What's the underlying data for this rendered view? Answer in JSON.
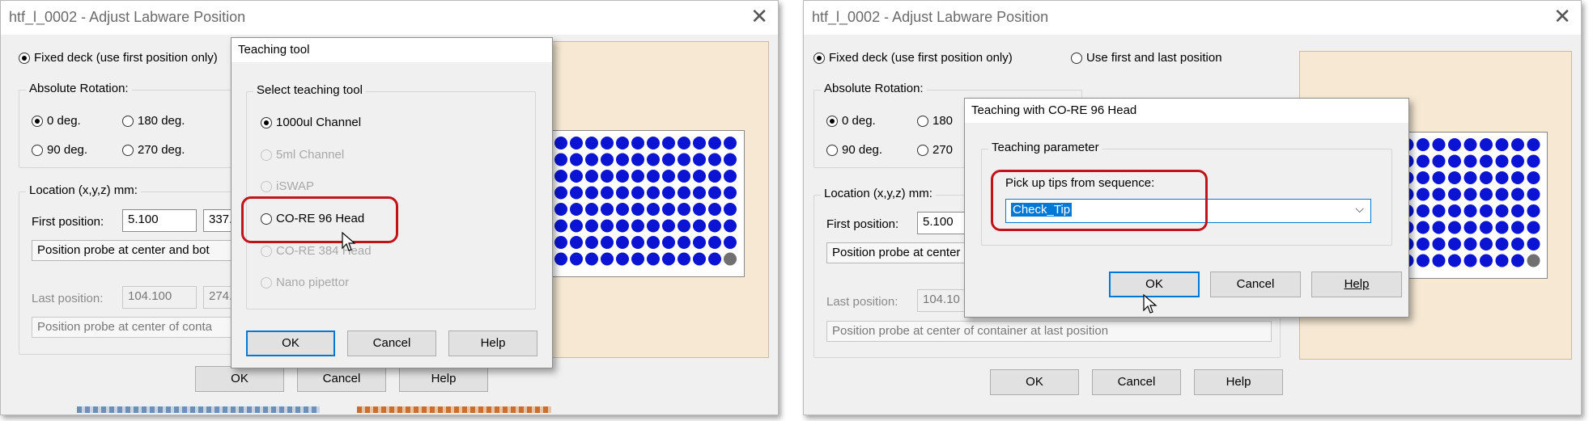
{
  "left": {
    "window_title": "htf_l_0002 - Adjust Labware Position",
    "fixed_deck_label": "Fixed deck (use first position only)",
    "rotation_group_label": "Absolute Rotation:",
    "rotation_0": "0 deg.",
    "rotation_180": "180 deg.",
    "rotation_90": "90 deg.",
    "rotation_270": "270 deg.",
    "location_group_label": "Location (x,y,z) mm:",
    "first_position_label": "First position:",
    "first_x": "5.100",
    "first_y": "337.",
    "first_info": "Position probe at center and bot",
    "last_position_label": "Last position:",
    "last_x": "104.100",
    "last_y": "274.",
    "last_info": "Position probe at center of conta",
    "ok": "OK",
    "cancel": "Cancel",
    "help": "Help",
    "teaching_dialog": {
      "title": "Teaching tool",
      "group_label": "Select teaching tool",
      "options": [
        "1000ul Channel",
        "5ml Channel",
        "iSWAP",
        "CO-RE 96 Head",
        "CO-RE 384 Head",
        "Nano pipettor"
      ],
      "ok": "OK",
      "cancel": "Cancel",
      "help": "Help"
    }
  },
  "right": {
    "window_title": "htf_l_0002 - Adjust Labware Position",
    "fixed_deck_label": "Fixed deck (use first position only)",
    "first_last_label": "Use first and last position",
    "rotation_group_label": "Absolute Rotation:",
    "rotation_0": "0 deg.",
    "rotation_180": "180",
    "rotation_90": "90 deg.",
    "rotation_270": "270",
    "location_group_label": "Location (x,y,z) mm:",
    "first_position_label": "First position:",
    "first_x": "5.100",
    "first_info": "Position probe at center",
    "last_position_label": "Last position:",
    "last_x": "104.10",
    "last_info": "Position probe at center of container at last position",
    "ok": "OK",
    "cancel": "Cancel",
    "help": "Help",
    "head_dialog": {
      "title": "Teaching with CO-RE 96 Head",
      "group_label": "Teaching parameter",
      "field_label": "Pick up tips from sequence:",
      "sequence_value": "Check_Tip",
      "ok": "OK",
      "cancel": "Cancel",
      "help": "Help"
    }
  },
  "colors": {
    "well_blue": "#0a14d2",
    "well_gray": "#707070",
    "preview_bg": "#f6e8d3",
    "highlight_red": "#c0141a",
    "focus_blue": "#0078d7"
  },
  "icons": {
    "close": "close-icon",
    "dropdown": "chevron-down-icon",
    "cursor": "mouse-pointer-icon"
  }
}
